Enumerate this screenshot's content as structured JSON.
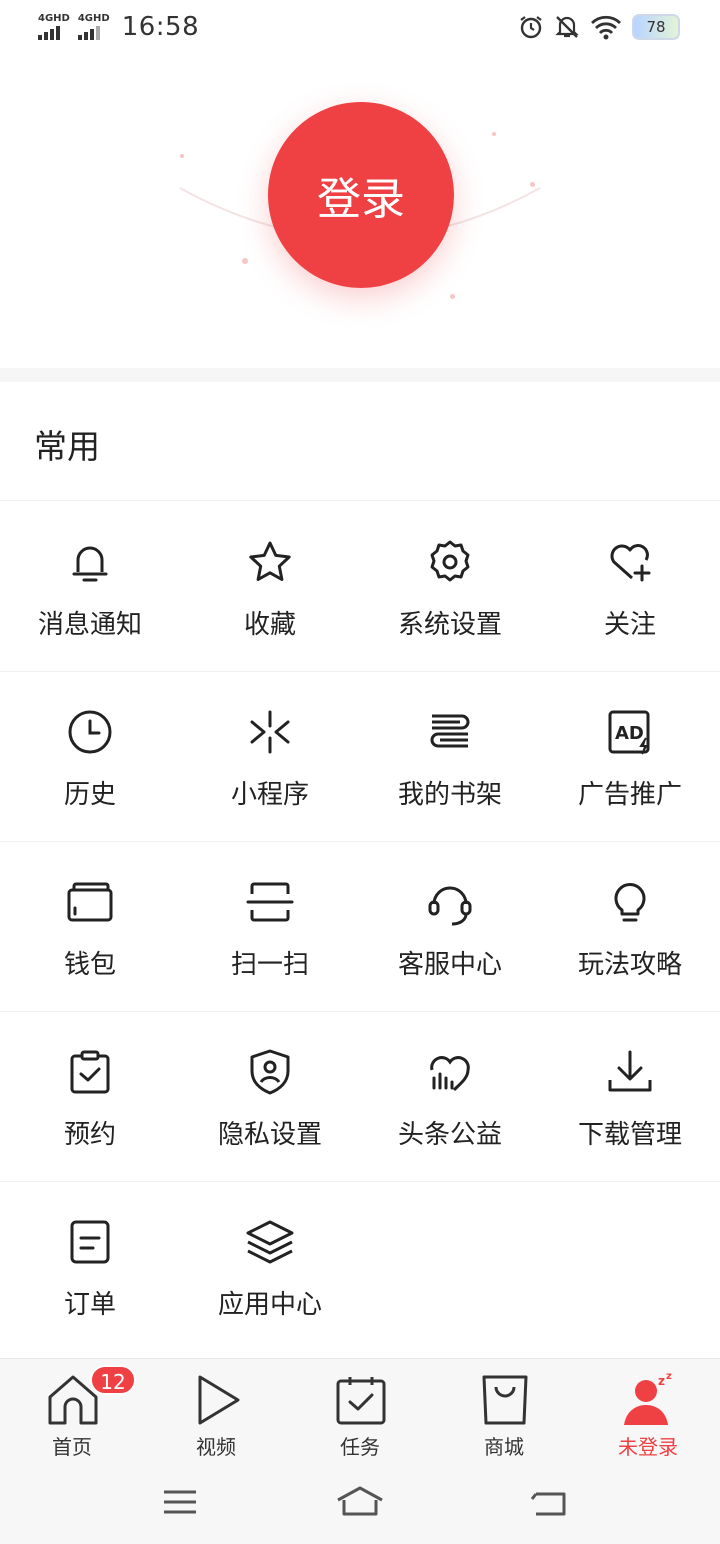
{
  "status": {
    "signal1": "4GHD",
    "signal2": "4GHD",
    "time": "16:58",
    "battery": "78"
  },
  "hero": {
    "login_label": "登录"
  },
  "section": {
    "title": "常用"
  },
  "grid": [
    [
      {
        "label": "消息通知",
        "icon": "bell-icon"
      },
      {
        "label": "收藏",
        "icon": "star-icon"
      },
      {
        "label": "系统设置",
        "icon": "gear-icon"
      },
      {
        "label": "关注",
        "icon": "heart-plus-icon"
      }
    ],
    [
      {
        "label": "历史",
        "icon": "clock-icon"
      },
      {
        "label": "小程序",
        "icon": "mini-program-icon"
      },
      {
        "label": "我的书架",
        "icon": "bookshelf-icon"
      },
      {
        "label": "广告推广",
        "icon": "ad-icon"
      }
    ],
    [
      {
        "label": "钱包",
        "icon": "wallet-icon"
      },
      {
        "label": "扫一扫",
        "icon": "scan-icon"
      },
      {
        "label": "客服中心",
        "icon": "headset-icon"
      },
      {
        "label": "玩法攻略",
        "icon": "lightbulb-icon"
      }
    ],
    [
      {
        "label": "预约",
        "icon": "clipboard-check-icon"
      },
      {
        "label": "隐私设置",
        "icon": "shield-user-icon"
      },
      {
        "label": "头条公益",
        "icon": "charity-heart-icon"
      },
      {
        "label": "下载管理",
        "icon": "download-icon"
      }
    ],
    [
      {
        "label": "订单",
        "icon": "order-icon"
      },
      {
        "label": "应用中心",
        "icon": "layers-icon"
      }
    ]
  ],
  "tabs": [
    {
      "label": "首页",
      "icon": "home-icon",
      "badge": "12"
    },
    {
      "label": "视频",
      "icon": "play-icon"
    },
    {
      "label": "任务",
      "icon": "task-icon"
    },
    {
      "label": "商城",
      "icon": "shopping-bag-icon"
    },
    {
      "label": "未登录",
      "icon": "user-sleep-icon",
      "active": true
    }
  ],
  "colors": {
    "accent": "#ef4044",
    "text": "#222222",
    "divider": "#f0f0f0"
  }
}
